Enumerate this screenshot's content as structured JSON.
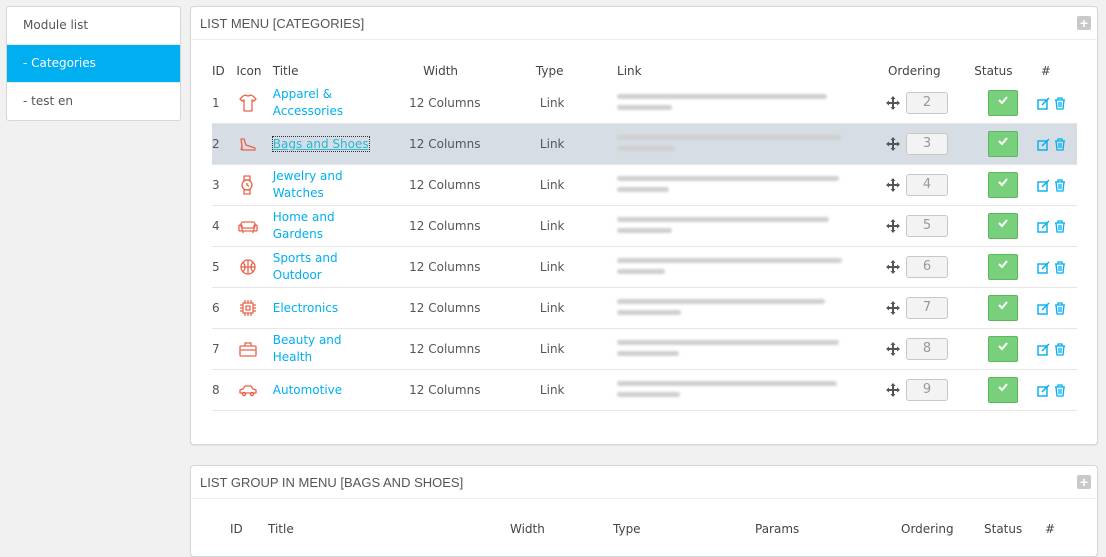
{
  "sidebar": {
    "items": [
      {
        "label": "Module list",
        "active": false
      },
      {
        "label": "- Categories",
        "active": true
      },
      {
        "label": "- test en",
        "active": false
      }
    ]
  },
  "menu_panel": {
    "title": "LIST MENU [CATEGORIES]",
    "columns": {
      "id": "ID",
      "icon": "Icon",
      "title": "Title",
      "width": "Width",
      "type": "Type",
      "link": "Link",
      "ordering": "Ordering",
      "status": "Status",
      "actions": "#"
    },
    "rows": [
      {
        "id": "1",
        "icon": "shirt-icon",
        "title": "Apparel & Accessories",
        "width": "12 Columns",
        "type": "Link",
        "ordering": "2",
        "highlight": false
      },
      {
        "id": "2",
        "icon": "shoe-icon",
        "title": "Bags and Shoes",
        "width": "12 Columns",
        "type": "Link",
        "ordering": "3",
        "highlight": true
      },
      {
        "id": "3",
        "icon": "watch-icon",
        "title": "Jewelry and Watches",
        "width": "12 Columns",
        "type": "Link",
        "ordering": "4",
        "highlight": false
      },
      {
        "id": "4",
        "icon": "sofa-icon",
        "title": "Home and Gardens",
        "width": "12 Columns",
        "type": "Link",
        "ordering": "5",
        "highlight": false
      },
      {
        "id": "5",
        "icon": "basketball-icon",
        "title": "Sports and Outdoor",
        "width": "12 Columns",
        "type": "Link",
        "ordering": "6",
        "highlight": false
      },
      {
        "id": "6",
        "icon": "chip-icon",
        "title": "Electronics",
        "width": "12 Columns",
        "type": "Link",
        "ordering": "7",
        "highlight": false
      },
      {
        "id": "7",
        "icon": "briefcase-icon",
        "title": "Beauty and Health",
        "width": "12 Columns",
        "type": "Link",
        "ordering": "8",
        "highlight": false
      },
      {
        "id": "8",
        "icon": "car-icon",
        "title": "Automotive",
        "width": "12 Columns",
        "type": "Link",
        "ordering": "9",
        "highlight": false
      }
    ]
  },
  "group_panel": {
    "title": "LIST GROUP IN MENU [BAGS AND SHOES]",
    "columns": {
      "id": "ID",
      "title": "Title",
      "width": "Width",
      "type": "Type",
      "params": "Params",
      "ordering": "Ordering",
      "status": "Status",
      "actions": "#"
    }
  },
  "colors": {
    "accent": "#00aff0",
    "icon": "#e8634a",
    "status": "#78d07d",
    "highlight": "#d7dde4"
  }
}
